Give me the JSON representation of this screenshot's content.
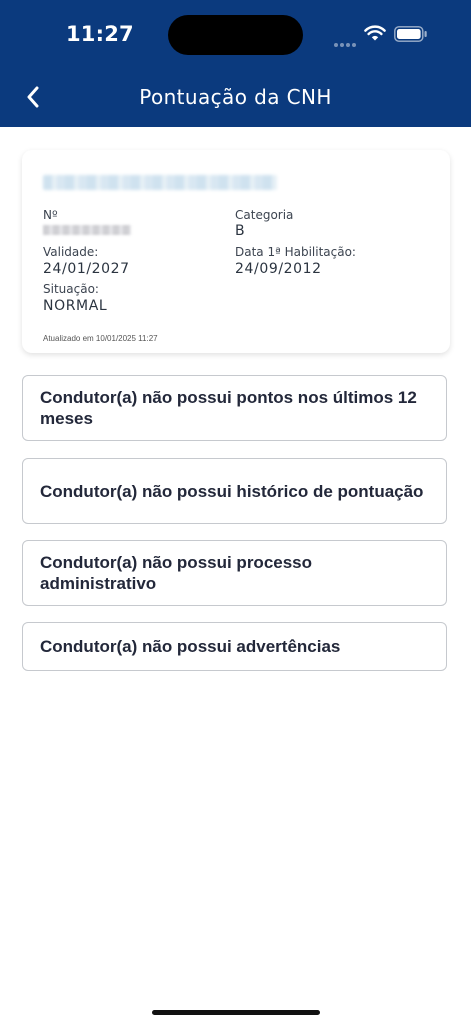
{
  "status_bar": {
    "time": "11:27"
  },
  "header": {
    "title": "Pontuação da CNH"
  },
  "card": {
    "number_label": "Nº",
    "category_label": "Categoria",
    "category_value": "B",
    "validity_label": "Validade:",
    "validity_value": "24/01/2027",
    "first_license_label": "Data 1ª Habilitação:",
    "first_license_value": "24/09/2012",
    "status_label": "Situação:",
    "status_value": "NORMAL",
    "updated": "Atualizado em 10/01/2025 11:27"
  },
  "info_items": [
    "Condutor(a) não possui pontos nos últimos 12 meses",
    "Condutor(a) não possui histórico de pontuação",
    "Condutor(a) não possui processo administrativo",
    "Condutor(a) não possui advertências"
  ],
  "colors": {
    "header_bg": "#0b3a7e",
    "text_dark": "#23283a"
  }
}
